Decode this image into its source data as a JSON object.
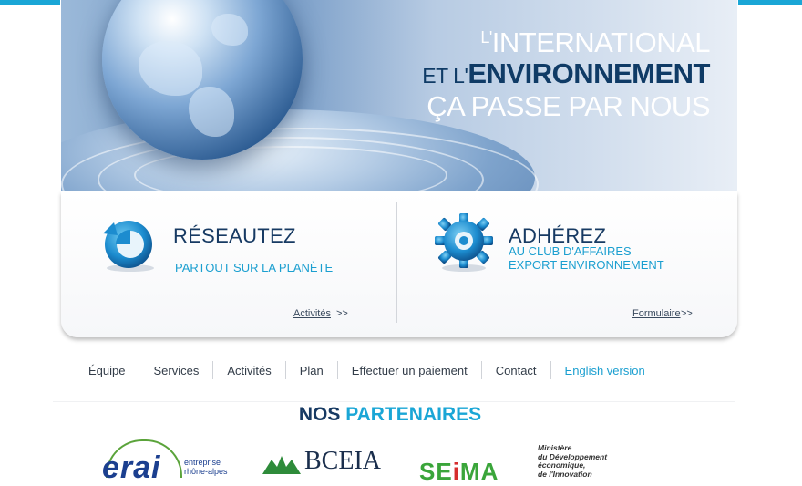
{
  "banner": {
    "line1_prefix": "L'",
    "line1": "INTERNATIONAL",
    "line2_prefix": "ET L'",
    "line2": "ENVIRONNEMENT",
    "line3": "ÇA PASSE PAR NOUS"
  },
  "panels": {
    "left": {
      "icon": "refresh-arrow-icon",
      "heading": "RÉSEAUTEZ",
      "subtitle": "PARTOUT SUR LA PLANÈTE",
      "link": "Activités",
      "arrow": ">>"
    },
    "right": {
      "icon": "gear-icon",
      "heading": "ADHÉREZ",
      "subtitle_line1": "AU CLUB D'AFFAIRES",
      "subtitle_line2": "EXPORT ENVIRONNEMENT",
      "link": "Formulaire",
      "arrow": ">>"
    }
  },
  "nav": {
    "items": [
      "Équipe",
      "Services",
      "Activités",
      "Plan",
      "Effectuer un paiement",
      "Contact",
      "English version"
    ]
  },
  "partners": {
    "title_part1": "NOS ",
    "title_part2": "PARTENAIRES",
    "logos": {
      "erai_word": "erai",
      "erai_tagline_1": "entreprise",
      "erai_tagline_2": "rhône-alpes",
      "bceia": "BCEIA",
      "seima_1": "SE",
      "seima_i": "i",
      "seima_2": "MA",
      "ministere_1": "Ministère",
      "ministere_2": "du Développement",
      "ministere_3": "économique,",
      "ministere_4": "de l'Innovation"
    }
  },
  "colors": {
    "accent": "#1aa6d6",
    "navy": "#173a63"
  }
}
